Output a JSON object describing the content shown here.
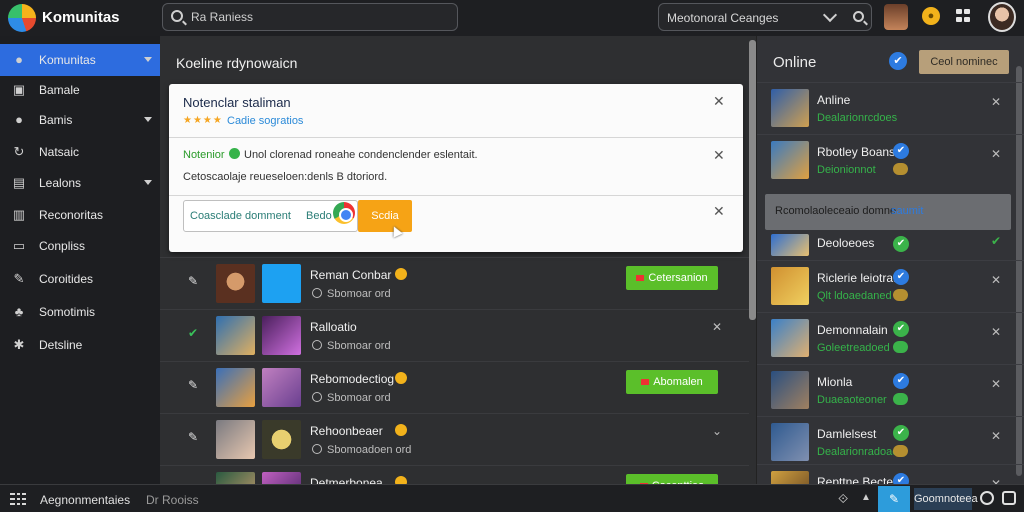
{
  "app": {
    "title": "Komunitas"
  },
  "search": {
    "placeholder": "Ra Raniess"
  },
  "filter": {
    "selected": "Meotonoral Ceanges"
  },
  "sidebar": {
    "items": [
      {
        "label": "Komunitas",
        "icon": "user-icon",
        "active": true,
        "caret": true
      },
      {
        "label": "Bamale",
        "icon": "image-icon",
        "active": false,
        "caret": false
      },
      {
        "label": "Bamis",
        "icon": "users-icon",
        "active": false,
        "caret": true
      },
      {
        "label": "Natsaic",
        "icon": "refresh-icon",
        "active": false,
        "caret": false
      },
      {
        "label": "Lealons",
        "icon": "chart-icon",
        "active": false,
        "caret": true
      },
      {
        "label": "Reconoritas",
        "icon": "columns-icon",
        "active": false,
        "caret": false
      },
      {
        "label": "Conpliss",
        "icon": "window-icon",
        "active": false,
        "caret": false
      },
      {
        "label": "Coroitides",
        "icon": "wrench-icon",
        "active": false,
        "caret": false
      },
      {
        "label": "Somotimis",
        "icon": "group-icon",
        "active": false,
        "caret": false
      },
      {
        "label": "Detsline",
        "icon": "gear-icon",
        "active": false,
        "caret": false
      }
    ]
  },
  "main": {
    "title": "Koeline rdynowaicn",
    "panel": {
      "title": "Notenclar staliman",
      "rating": "★★★★",
      "subtitle": "Cadie sogratios",
      "line1_status": "Notenior",
      "line1_text": "Unol clorenad roneahe condenclender eslentait.",
      "line2_text": "Cetoscaolaje reueseloen:denls B dtoriord.",
      "input_value": "Coasclade domment",
      "input_tag": "Bedo",
      "button_label": "Scdia"
    },
    "rows": [
      {
        "name": "Reman Conbar",
        "meta": "Sbomoar ord",
        "badge": true,
        "checked": false,
        "button": "Cetersanion",
        "close": false
      },
      {
        "name": "Ralloatio",
        "meta": "Sbomoar ord",
        "badge": false,
        "checked": true,
        "button": "",
        "close": true
      },
      {
        "name": "Rebomodectiog",
        "meta": "Sbomoar ord",
        "badge": true,
        "checked": false,
        "button": "Abomalen",
        "close": false
      },
      {
        "name": "Rehoonbeaer",
        "meta": "Sbomoadoen ord",
        "badge": true,
        "checked": false,
        "button": "",
        "close": true
      },
      {
        "name": "Detmerbonea",
        "meta": "",
        "badge": true,
        "checked": true,
        "button": "Cocenttiea",
        "close": false
      }
    ]
  },
  "right": {
    "title": "Online",
    "button": "Ceol nominec",
    "banner": {
      "text": "Rcomolaoleceaio domne",
      "link": "saumit"
    },
    "users": [
      {
        "name": "Anline",
        "sub": "Dealarionrcdoes",
        "ck": "blue",
        "dot": "",
        "x": "gray"
      },
      {
        "name": "Rbotley Boans",
        "sub": "Deionionnot",
        "ck": "blue",
        "dot": "gold",
        "x": "gray"
      },
      {
        "name": "Deoloeoes",
        "sub": "",
        "ck": "green",
        "dot": "",
        "x": "green"
      },
      {
        "name": "Riclerie leiotrat",
        "sub": "Qlt ldoaedaned",
        "ck": "blue",
        "dot": "gold",
        "x": "gray"
      },
      {
        "name": "Demonnalain",
        "sub": "Goleetreadoed",
        "ck": "green",
        "dot": "green",
        "x": "gray"
      },
      {
        "name": "Mionla",
        "sub": "Duaeaoteoner",
        "ck": "blue",
        "dot": "green",
        "x": "gray"
      },
      {
        "name": "Damlelsest",
        "sub": "Dealarionradoaes",
        "ck": "green",
        "dot": "gold",
        "x": "gray"
      },
      {
        "name": "Repttne Bectet",
        "sub": "",
        "ck": "blue",
        "dot": "",
        "x": "gray"
      }
    ]
  },
  "bottombar": {
    "label": "Aegnonmentaies",
    "secondary": "Dr Rooiss",
    "community": "Goomnoteea"
  },
  "colors": {
    "accent_blue": "#2d6cdf",
    "green_button": "#5bbf2a",
    "orange_button": "#f6a315",
    "panel_bg": "#fbfbfb"
  }
}
